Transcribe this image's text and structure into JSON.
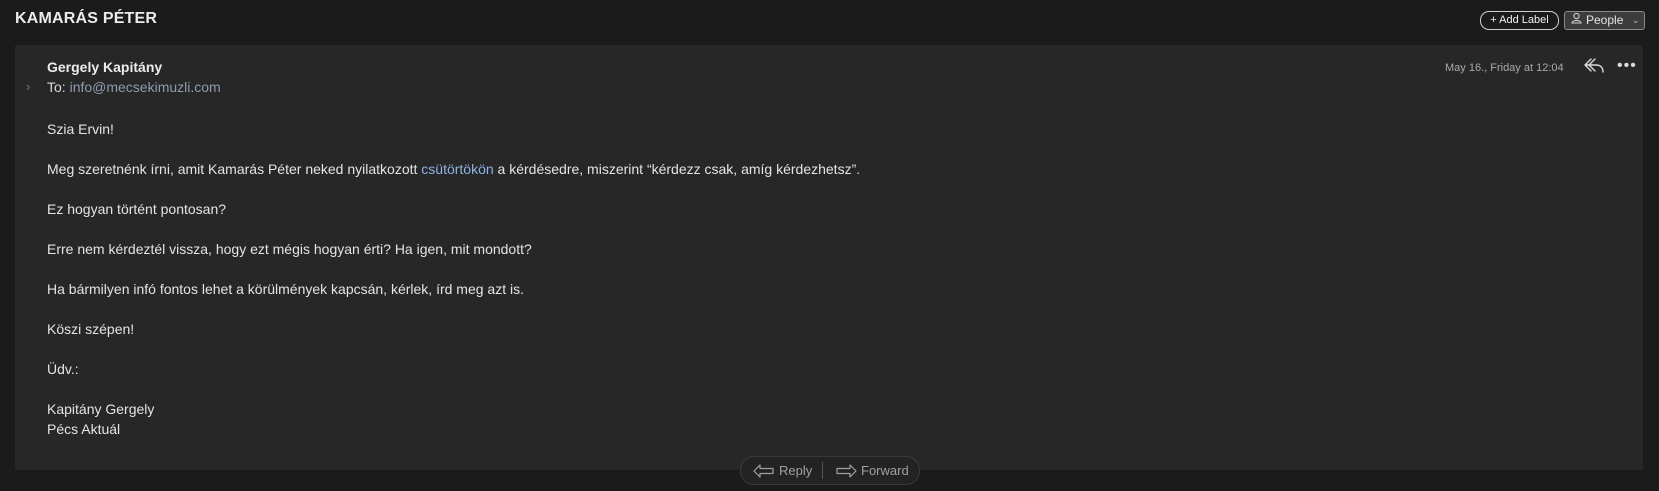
{
  "header": {
    "subject": "KAMARÁS PÉTER",
    "add_label": "+ Add Label",
    "people_label": "People"
  },
  "message": {
    "sender": "Gergely Kapitány",
    "to_prefix": "To:",
    "to_address": "info@mecsekimuzli.com",
    "date": "May 16., Friday at 12:04",
    "greeting": "Szia Ervin!",
    "p1_before": "Meg szeretnénk írni, amit Kamarás Péter neked nyilatkozott ",
    "p1_link": "csütörtökön",
    "p1_after": " a kérdésedre, miszerint “kérdezz csak, amíg kérdezhetsz”.",
    "p2": "Ez hogyan történt pontosan?",
    "p3": "Erre nem kérdeztél vissza, hogy ezt mégis hogyan érti? Ha igen, mit mondott?",
    "p4": "Ha bármilyen infó fontos lehet a körülmények kapcsán, kérlek, írd meg azt is.",
    "p5": "Köszi szépen!",
    "p6": "Üdv.:",
    "sig_name": "Kapitány Gergely",
    "sig_org": "Pécs Aktuál"
  },
  "actions": {
    "reply": "Reply",
    "forward": "Forward"
  },
  "icons": {
    "reply": "reply-icon",
    "more": "more-icon",
    "people": "person-icon",
    "chevron": "chevron-down-icon",
    "expand": "chevron-right-icon",
    "forward": "forward-icon"
  },
  "colors": {
    "background": "#1b1b1b",
    "card": "#272727",
    "link": "#8fb3e6",
    "address": "#8f9bb0"
  }
}
